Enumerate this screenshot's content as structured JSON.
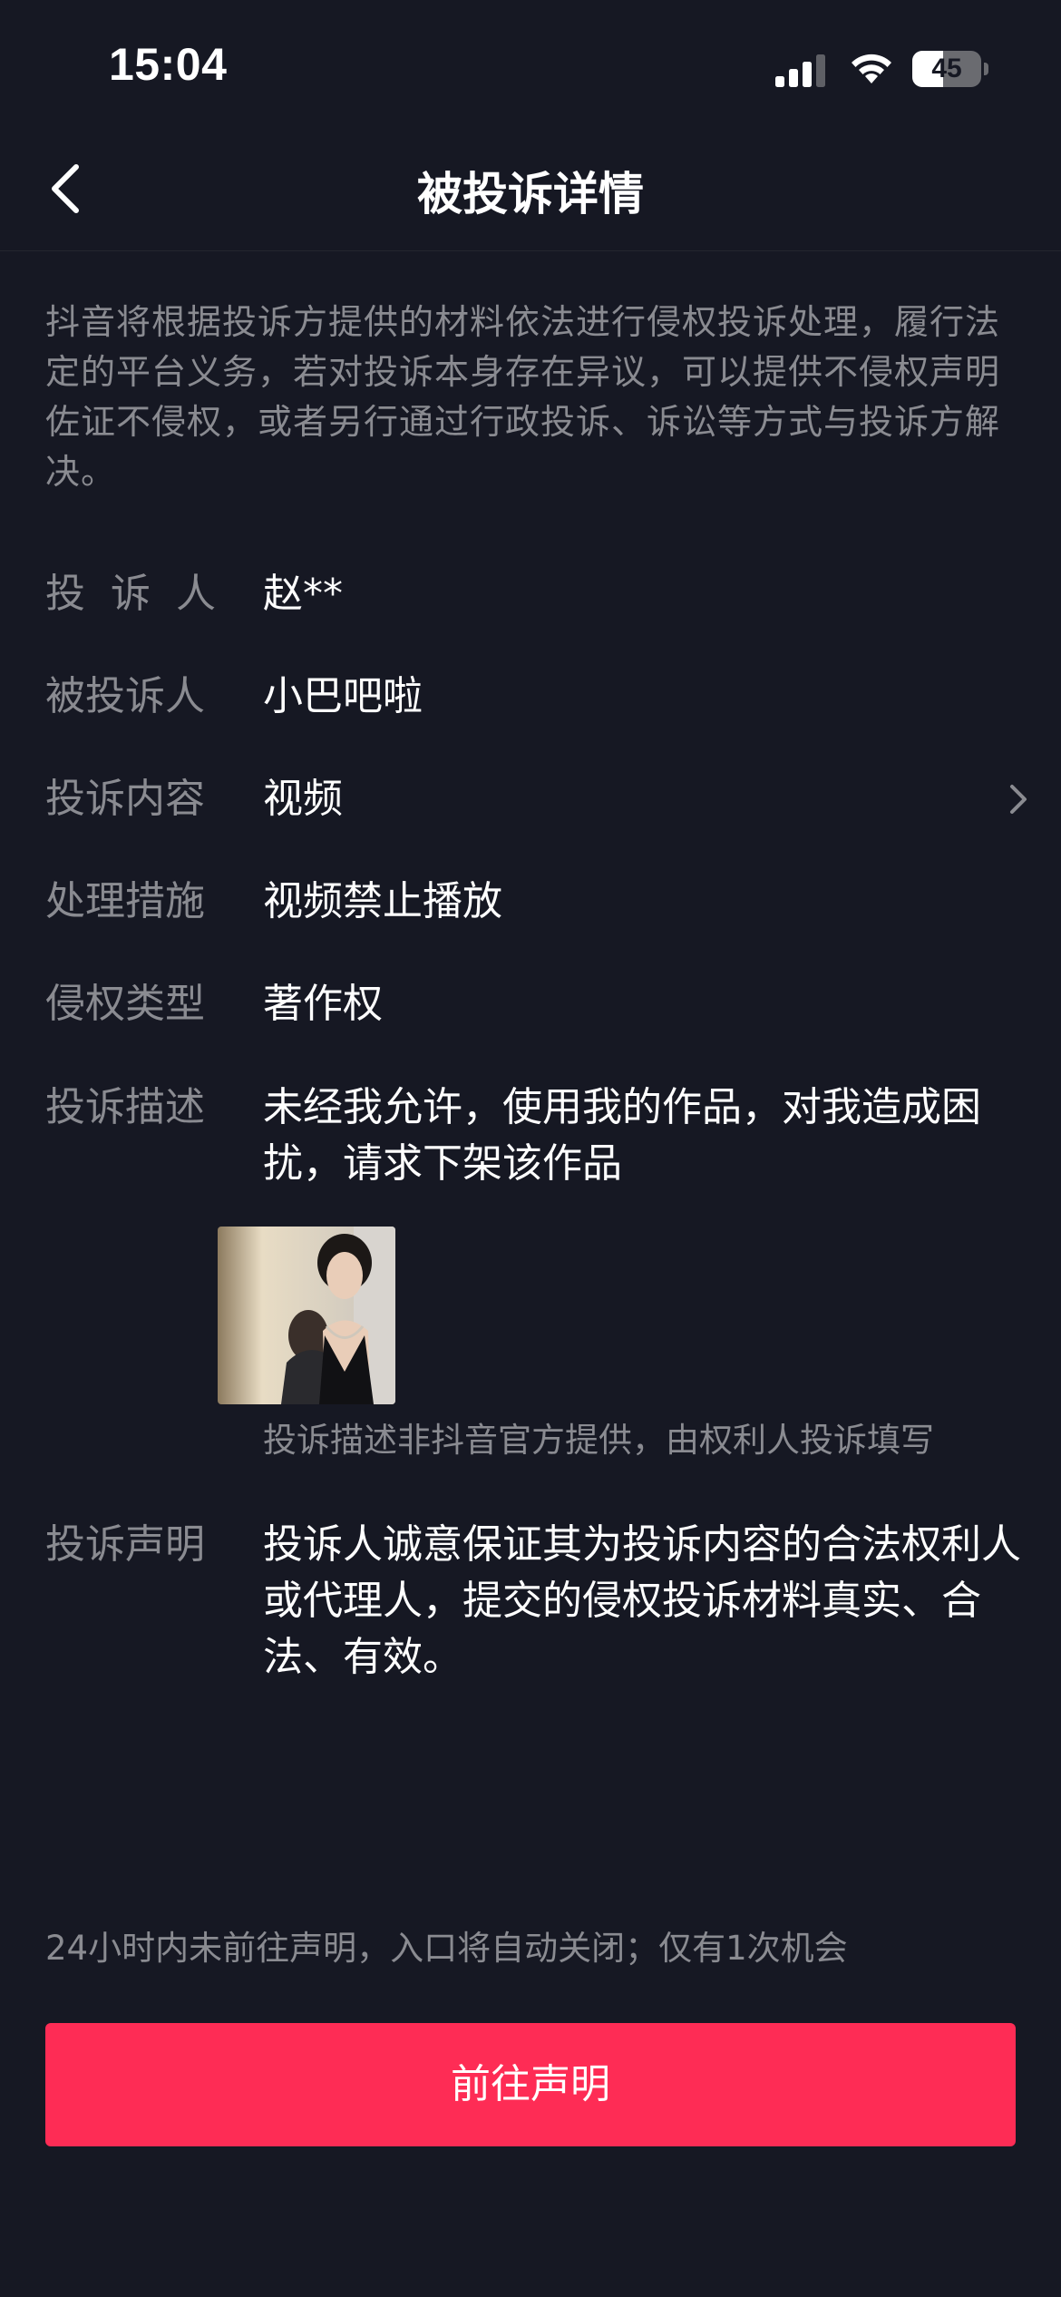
{
  "status_bar": {
    "time": "15:04",
    "battery_level": 45,
    "battery_text": "45"
  },
  "nav": {
    "title": "被投诉详情"
  },
  "notice": "抖音将根据投诉方提供的材料依法进行侵权投诉处理，履行法定的平台义务，若对投诉本身存在异议，可以提供不侵权声明佐证不侵权，或者另行通过行政投诉、诉讼等方式与投诉方解决。",
  "details": {
    "complainant": {
      "label": "投诉人",
      "value": "赵**"
    },
    "respondent": {
      "label": "被投诉人",
      "value": "小巴吧啦"
    },
    "content": {
      "label": "投诉内容",
      "value": "视频"
    },
    "measure": {
      "label": "处理措施",
      "value": "视频禁止播放"
    },
    "infringement_type": {
      "label": "侵权类型",
      "value": "著作权"
    },
    "description": {
      "label": "投诉描述",
      "value": "未经我允许，使用我的作品，对我造成困扰，请求下架该作品",
      "note": "投诉描述非抖音官方提供，由权利人投诉填写"
    },
    "statement": {
      "label": "投诉声明",
      "value": "投诉人诚意保证其为投诉内容的合法权利人或代理人，提交的侵权投诉材料真实、合法、有效。"
    }
  },
  "footer": {
    "deadline_note": "24小时内未前往声明，入口将自动关闭；仅有1次机会",
    "cta_label": "前往声明"
  },
  "colors": {
    "background": "#161823",
    "accent": "#fe2c55",
    "secondary_text": "#8a8b91"
  }
}
